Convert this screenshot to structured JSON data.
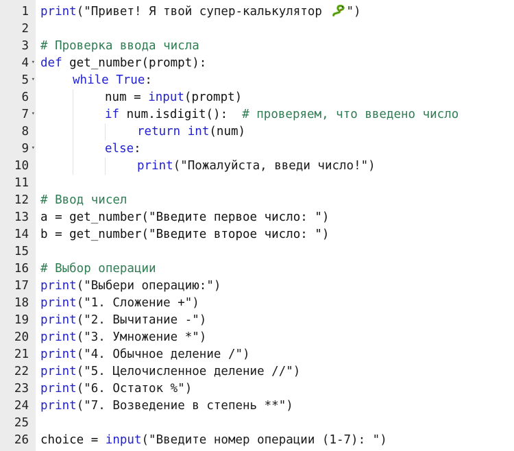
{
  "editor": {
    "line_numbers": [
      "1",
      "2",
      "3",
      "4",
      "5",
      "6",
      "7",
      "8",
      "9",
      "10",
      "11",
      "12",
      "13",
      "14",
      "15",
      "16",
      "17",
      "18",
      "19",
      "20",
      "21",
      "22",
      "23",
      "24",
      "25",
      "26"
    ],
    "fold_markers": [
      "4",
      "5",
      "7",
      "9"
    ],
    "lines": [
      {
        "indent": 0,
        "tokens": [
          {
            "t": "print",
            "c": "kw"
          },
          {
            "t": "(\"Привет! Я твой супер-калькулятор ",
            "c": "str"
          },
          {
            "icon": "snake-emoji"
          },
          {
            "t": "\")",
            "c": "str"
          }
        ]
      },
      {
        "indent": 0,
        "tokens": []
      },
      {
        "indent": 0,
        "tokens": [
          {
            "t": "# Проверка ввода числа",
            "c": "cmt"
          }
        ]
      },
      {
        "indent": 0,
        "tokens": [
          {
            "t": "def",
            "c": "kw"
          },
          {
            "t": " get_number(prompt):",
            "c": "plain"
          }
        ]
      },
      {
        "indent": 1,
        "tokens": [
          {
            "t": "while",
            "c": "kw"
          },
          {
            "t": " ",
            "c": "plain"
          },
          {
            "t": "True",
            "c": "kw"
          },
          {
            "t": ":",
            "c": "plain"
          }
        ]
      },
      {
        "indent": 2,
        "tokens": [
          {
            "t": "num = ",
            "c": "plain"
          },
          {
            "t": "input",
            "c": "kw"
          },
          {
            "t": "(prompt)",
            "c": "plain"
          }
        ]
      },
      {
        "indent": 2,
        "tokens": [
          {
            "t": "if",
            "c": "kw"
          },
          {
            "t": " num.isdigit():  ",
            "c": "plain"
          },
          {
            "t": "# проверяем, что введено число",
            "c": "cmt"
          }
        ]
      },
      {
        "indent": 3,
        "tokens": [
          {
            "t": "return",
            "c": "kw"
          },
          {
            "t": " ",
            "c": "plain"
          },
          {
            "t": "int",
            "c": "kw"
          },
          {
            "t": "(num)",
            "c": "plain"
          }
        ]
      },
      {
        "indent": 2,
        "tokens": [
          {
            "t": "else",
            "c": "kw"
          },
          {
            "t": ":",
            "c": "plain"
          }
        ]
      },
      {
        "indent": 3,
        "tokens": [
          {
            "t": "print",
            "c": "kw"
          },
          {
            "t": "(\"Пожалуйста, введи число!\")",
            "c": "str"
          }
        ]
      },
      {
        "indent": 0,
        "tokens": []
      },
      {
        "indent": 0,
        "tokens": [
          {
            "t": "# Ввод чисел",
            "c": "cmt"
          }
        ]
      },
      {
        "indent": 0,
        "tokens": [
          {
            "t": "a = get_number(\"Введите первое число: \")",
            "c": "plain"
          }
        ]
      },
      {
        "indent": 0,
        "tokens": [
          {
            "t": "b = get_number(\"Введите второе число: \")",
            "c": "plain"
          }
        ]
      },
      {
        "indent": 0,
        "tokens": []
      },
      {
        "indent": 0,
        "tokens": [
          {
            "t": "# Выбор операции",
            "c": "cmt"
          }
        ]
      },
      {
        "indent": 0,
        "tokens": [
          {
            "t": "print",
            "c": "kw"
          },
          {
            "t": "(\"Выбери операцию:\")",
            "c": "str"
          }
        ]
      },
      {
        "indent": 0,
        "tokens": [
          {
            "t": "print",
            "c": "kw"
          },
          {
            "t": "(\"1. Сложение +\")",
            "c": "str"
          }
        ]
      },
      {
        "indent": 0,
        "tokens": [
          {
            "t": "print",
            "c": "kw"
          },
          {
            "t": "(\"2. Вычитание -\")",
            "c": "str"
          }
        ]
      },
      {
        "indent": 0,
        "tokens": [
          {
            "t": "print",
            "c": "kw"
          },
          {
            "t": "(\"3. Умножение *\")",
            "c": "str"
          }
        ]
      },
      {
        "indent": 0,
        "tokens": [
          {
            "t": "print",
            "c": "kw"
          },
          {
            "t": "(\"4. Обычное деление /\")",
            "c": "str"
          }
        ]
      },
      {
        "indent": 0,
        "tokens": [
          {
            "t": "print",
            "c": "kw"
          },
          {
            "t": "(\"5. Целочисленное деление //\")",
            "c": "str"
          }
        ]
      },
      {
        "indent": 0,
        "tokens": [
          {
            "t": "print",
            "c": "kw"
          },
          {
            "t": "(\"6. Остаток %\")",
            "c": "str"
          }
        ]
      },
      {
        "indent": 0,
        "tokens": [
          {
            "t": "print",
            "c": "kw"
          },
          {
            "t": "(\"7. Возведение в степень **\")",
            "c": "str"
          }
        ]
      },
      {
        "indent": 0,
        "tokens": []
      },
      {
        "indent": 0,
        "tokens": [
          {
            "t": "choice = ",
            "c": "plain"
          },
          {
            "t": "input",
            "c": "kw"
          },
          {
            "t": "(\"Введите номер операции (1-7): \")",
            "c": "str"
          }
        ]
      }
    ]
  }
}
